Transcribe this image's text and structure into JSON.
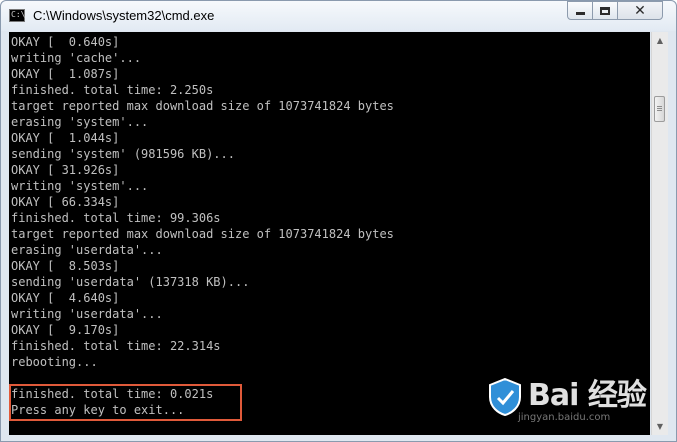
{
  "window": {
    "title": "C:\\Windows\\system32\\cmd.exe",
    "icon_glyph": "C:\\",
    "controls": {
      "minimize": "minimize-icon",
      "maximize": "maximize-icon",
      "close": "close-icon",
      "close_glyph": "✕"
    }
  },
  "console": {
    "lines": [
      "OKAY [  0.640s]",
      "writing 'cache'...",
      "OKAY [  1.087s]",
      "finished. total time: 2.250s",
      "target reported max download size of 1073741824 bytes",
      "erasing 'system'...",
      "OKAY [  1.044s]",
      "sending 'system' (981596 KB)...",
      "OKAY [ 31.926s]",
      "writing 'system'...",
      "OKAY [ 66.334s]",
      "finished. total time: 99.306s",
      "target reported max download size of 1073741824 bytes",
      "erasing 'userdata'...",
      "OKAY [  8.503s]",
      "sending 'userdata' (137318 KB)...",
      "OKAY [  4.640s]",
      "writing 'userdata'...",
      "OKAY [  9.170s]",
      "finished. total time: 22.314s",
      "rebooting...",
      "",
      "finished. total time: 0.021s",
      "Press any key to exit..."
    ],
    "text_color": "#c0c0c0",
    "background": "#000000",
    "highlight_color": "#e05a3a"
  },
  "scrollbar": {
    "up_glyph": "▲",
    "down_glyph": "▼"
  },
  "watermark": {
    "text": "Bai 经验",
    "url": "jingyan.baidu.com"
  }
}
